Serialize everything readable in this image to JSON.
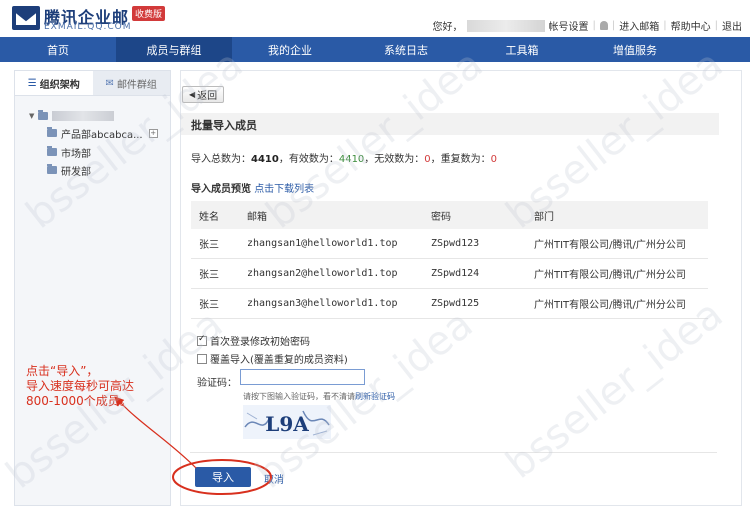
{
  "brand": {
    "name": "腾讯企业邮",
    "domain": "EXMAIL.QQ.COM",
    "edition_badge": "收费版"
  },
  "top_links": {
    "greeting": "您好，",
    "account_settings": "帐号设置",
    "enter_mail": "进入邮箱",
    "help_center": "帮助中心",
    "logout": "退出",
    "separator": "|"
  },
  "nav": {
    "items": [
      {
        "label": "首页"
      },
      {
        "label": "成员与群组"
      },
      {
        "label": "我的企业"
      },
      {
        "label": "系统日志"
      },
      {
        "label": "工具箱"
      },
      {
        "label": "增值服务"
      }
    ],
    "active_index": 1
  },
  "sidebar": {
    "tab_org": "组织架构",
    "tab_group": "邮件群组",
    "tree": [
      {
        "label": "产品部abcabca..."
      },
      {
        "label": "市场部"
      },
      {
        "label": "研发部"
      }
    ],
    "expand_symbol": "+",
    "collapse_symbol": "▼"
  },
  "main": {
    "back_label": "返回",
    "back_arrow": "◀",
    "title": "批量导入成员",
    "summary": {
      "total_label": "导入总数为：",
      "total": "4410",
      "valid_label": "，有效数为：",
      "valid": "4410",
      "invalid_label": "，无效数为：",
      "invalid": "0",
      "dup_label": "，重复数为：",
      "dup": "0"
    },
    "preview_label": "导入成员预览",
    "download_link": "点击下载列表",
    "table": {
      "headers": [
        "姓名",
        "邮箱",
        "密码",
        "部门"
      ],
      "rows": [
        [
          "张三",
          "zhangsan1@helloworld1.top",
          "ZSpwd123",
          "广州TIT有限公司/腾讯/广州分公司"
        ],
        [
          "张三",
          "zhangsan2@helloworld1.top",
          "ZSpwd124",
          "广州TIT有限公司/腾讯/广州分公司"
        ],
        [
          "张三",
          "zhangsan3@helloworld1.top",
          "ZSpwd125",
          "广州TIT有限公司/腾讯/广州分公司"
        ]
      ]
    },
    "checkbox_first_login": "首次登录修改初始密码",
    "checkbox_first_login_checked": true,
    "checkbox_overwrite": "覆盖导入(覆盖重复的成员资料)",
    "checkbox_overwrite_checked": false,
    "captcha_label": "验证码：",
    "captcha_value": "",
    "captcha_hint": "请按下图输入验证码，看不清请",
    "captcha_refresh": "刷新验证码",
    "captcha_image_text": "L9A",
    "import_button": "导入",
    "cancel_link": "取消"
  },
  "annotation": {
    "text": "点击“导入”，\n导入速度每秒可高达\n800-1000个成员。"
  },
  "watermark": "bsseller_idea",
  "colors": {
    "nav_bg": "#2a5aa6",
    "nav_active": "#1d4688",
    "accent": "#2a5aa6",
    "annotation": "#d8301e",
    "valid_green": "#3b8b3b",
    "zero_red": "#d23a3a"
  }
}
